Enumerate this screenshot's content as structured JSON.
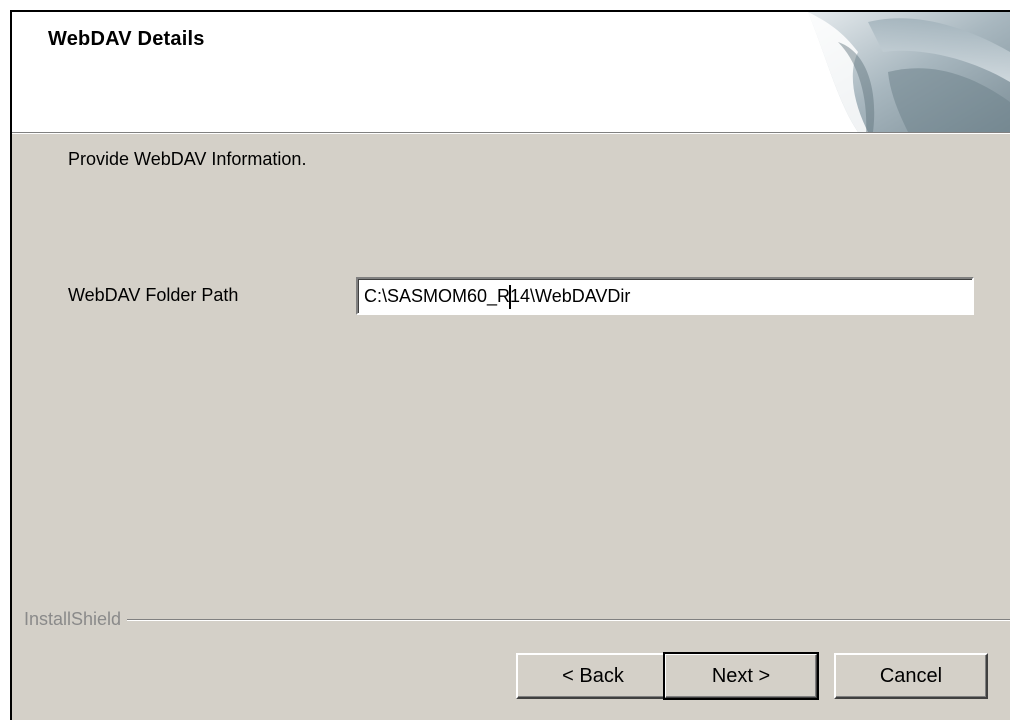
{
  "dialog": {
    "title": "WebDAV Details",
    "subtitle": "Provide WebDAV Information."
  },
  "form": {
    "folder_path_label": "WebDAV Folder Path",
    "folder_path_value": "C:\\SASMOM60_R14\\WebDAVDir"
  },
  "footer": {
    "brand": "InstallShield",
    "back_label": "< Back",
    "next_label": "Next >",
    "cancel_label": "Cancel"
  },
  "colors": {
    "dialog_background": "#d4d0c8",
    "header_background": "#ffffff",
    "brand_text": "#8a8a8a"
  },
  "icons": {
    "header_graphic": "installshield-swirl-graphic"
  }
}
